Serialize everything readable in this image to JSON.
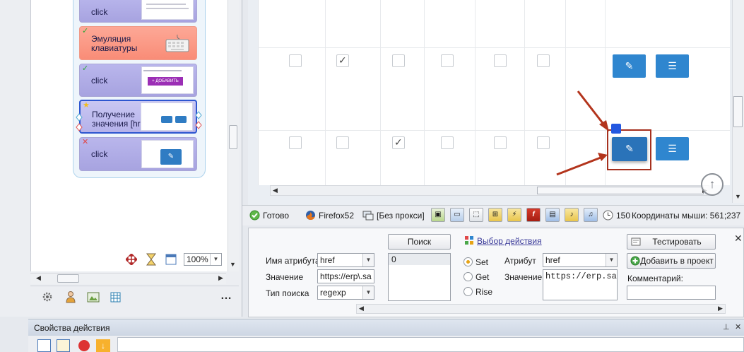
{
  "flow": {
    "nodes": [
      {
        "label": "click",
        "status": "ok"
      },
      {
        "label": "Эмуляция клавиатуры",
        "status": "ok"
      },
      {
        "label": "click",
        "status": "ok",
        "thumb_text": "+ ДОБАВИТЬ ЗАПИСЬ"
      },
      {
        "label": "Получение значения [href]",
        "status": "current"
      },
      {
        "label": "click",
        "status": "error"
      }
    ],
    "zoom": "100%"
  },
  "browser": {
    "status": "Готово",
    "browser_name": "Firefox52",
    "proxy": "[Без прокси]",
    "counter": "150",
    "mouse_coords": "Координаты мыши: 561;237"
  },
  "action_panel": {
    "attr_name_label": "Имя атрибута",
    "attr_name_value": "href",
    "value_label": "Значение",
    "value_value": "https://erp\\.sa",
    "search_type_label": "Тип поиска",
    "search_type_value": "regexp",
    "search_button": "Поиск",
    "result_index": "0",
    "choose_action_link": "Выбор действия",
    "radio_set": "Set",
    "radio_get": "Get",
    "radio_rise": "Rise",
    "attribute_label": "Атрибут",
    "attribute_value": "href",
    "value2_label": "Значение",
    "value2_value": "https://erp.sa",
    "test_button": "Тестировать",
    "add_button": "Добавить в проект",
    "comment_label": "Комментарий:",
    "comment_value": ""
  },
  "properties": {
    "title": "Свойства действия"
  },
  "colors": {
    "accent_blue": "#2f86cf",
    "highlight_red": "#a5301e",
    "node_purple": "#a7a3e0",
    "node_red": "#f98c77"
  }
}
